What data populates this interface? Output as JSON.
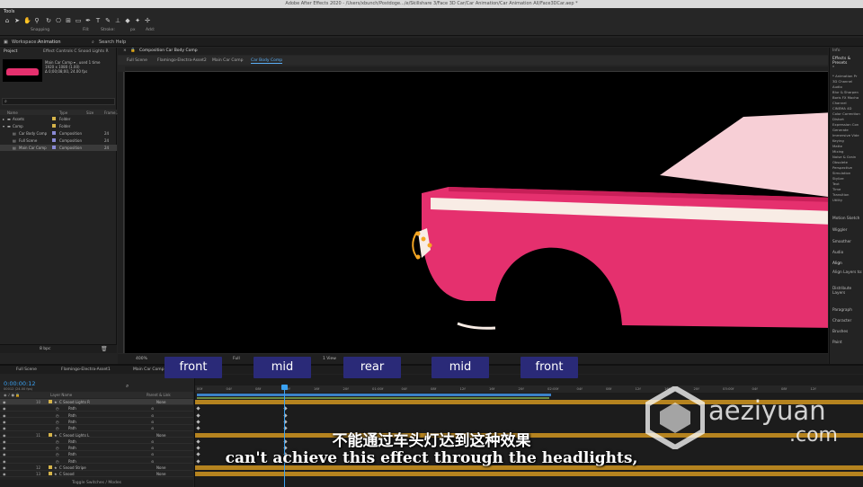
{
  "window_title": "Adobe After Effects 2020 - /Users/xbunch/Postdoge.../e/Skillshare 3/Face 3D Car/Car Animation/Car Animation All/Face3DCar.aep *",
  "toolbar": {
    "label": "Tools",
    "snapping": "Snapping",
    "fill_label": "Fill:",
    "stroke_label": "Stroke:",
    "px_label": "px",
    "add_label": "Add:"
  },
  "workspace": {
    "label": "Workspace:",
    "value": "Animation",
    "search": "Search Help"
  },
  "project_panel": {
    "tab_project": "Project",
    "tab_effects": "Effect Controls C Snood Lights R",
    "comp_name": "Main Car Comp ▾ , used 1 time",
    "comp_size": "1920 x 1080 (1.00)",
    "comp_duration": "Δ 0;00;08;00, 24.00 fps",
    "headers": {
      "name": "Name",
      "type": "Type",
      "size": "Size",
      "frame": "Frame..."
    },
    "rows": [
      {
        "name": "Assets",
        "type": "Folder",
        "size": "",
        "frame": ""
      },
      {
        "name": "Comp",
        "type": "Folder",
        "size": "",
        "frame": ""
      },
      {
        "name": "Car Body Comp",
        "type": "Composition",
        "size": "",
        "frame": "24"
      },
      {
        "name": "Full Scene",
        "type": "Composition",
        "size": "",
        "frame": "24"
      },
      {
        "name": "Main Car Comp",
        "type": "Composition",
        "size": "",
        "frame": "24"
      }
    ],
    "footer_bpc": "8 bpc"
  },
  "composition_panel": {
    "tab": "Composition Car Body Comp",
    "subtabs": [
      "Full Scene",
      "Flamingo-Electra-Asset2",
      "Main Car Comp",
      "Car Body Comp"
    ],
    "zoom": "400%",
    "resolution": "Full",
    "view": "1 View"
  },
  "right_panel": {
    "info": "Info",
    "effects_presets": "Effects & Presets",
    "categories": [
      "* Animation Pr",
      "3D Channel",
      "Audio",
      "Blur & Sharpen",
      "Boris FX Mocha",
      "Channel",
      "CINEMA 4D",
      "Color Correction",
      "Distort",
      "Expression Con",
      "Generate",
      "Immersive Vide",
      "Keying",
      "Matte",
      "Mixing",
      "Noise & Grain",
      "Obsolete",
      "Perspective",
      "Simulation",
      "Stylize",
      "Text",
      "Time",
      "Transition",
      "Utility"
    ],
    "sections": [
      "Motion Sketch",
      "Wiggler",
      "Smoother",
      "Audio",
      "Align",
      "Align Layers to:",
      "Distribute Layers",
      "Paragraph",
      "Character",
      "Brushes",
      "Paint"
    ]
  },
  "timeline": {
    "tabs": [
      "Full Scene",
      "Flamingo-Electra-Asset1",
      "Main Car Comp"
    ],
    "timecode": "0:00:00:12",
    "fps_info": "00012 (24.00 fps)",
    "columns": {
      "layer_name": "Layer Name",
      "parent": "Parent & Link"
    },
    "layers": [
      {
        "num": "10",
        "name": "C Snood Lights R",
        "parent": "None",
        "kind": "layer"
      },
      {
        "num": "",
        "name": "Path",
        "parent": "",
        "kind": "prop"
      },
      {
        "num": "",
        "name": "Path",
        "parent": "",
        "kind": "prop"
      },
      {
        "num": "",
        "name": "Path",
        "parent": "",
        "kind": "prop"
      },
      {
        "num": "",
        "name": "Path",
        "parent": "",
        "kind": "prop"
      },
      {
        "num": "11",
        "name": "C Snood Lights L",
        "parent": "None",
        "kind": "layer"
      },
      {
        "num": "",
        "name": "Path",
        "parent": "",
        "kind": "prop"
      },
      {
        "num": "",
        "name": "Path",
        "parent": "",
        "kind": "prop"
      },
      {
        "num": "",
        "name": "Path",
        "parent": "",
        "kind": "prop"
      },
      {
        "num": "",
        "name": "Path",
        "parent": "",
        "kind": "prop"
      },
      {
        "num": "12",
        "name": "C Snood Stripe",
        "parent": "None",
        "kind": "layer"
      },
      {
        "num": "13",
        "name": "C Snood",
        "parent": "None",
        "kind": "layer"
      }
    ],
    "footer": "Toggle Switches / Modes",
    "ruler_ticks": [
      "00f",
      "04f",
      "08f",
      "12f",
      "16f",
      "20f",
      "01:00f",
      "04f",
      "08f",
      "12f",
      "16f",
      "20f",
      "02:00f",
      "04f",
      "08f",
      "12f",
      "16f",
      "20f",
      "03:00f",
      "04f",
      "08f",
      "12f"
    ]
  },
  "overlay_labels": [
    "front",
    "mid",
    "rear",
    "mid",
    "front"
  ],
  "subtitles": {
    "chinese": "不能通过车头灯达到这种效果",
    "english": "can't achieve this effect through the headlights,"
  },
  "watermark": {
    "text": "aeziyuan",
    "domain": ".com"
  },
  "colors": {
    "car_body": "#e5306e",
    "car_stripe": "#f8ece5",
    "car_window": "#f7cfd6",
    "timecode": "#3aa1f2",
    "label_bg": "#2a2a78",
    "layer_bar": "#b5831f"
  }
}
